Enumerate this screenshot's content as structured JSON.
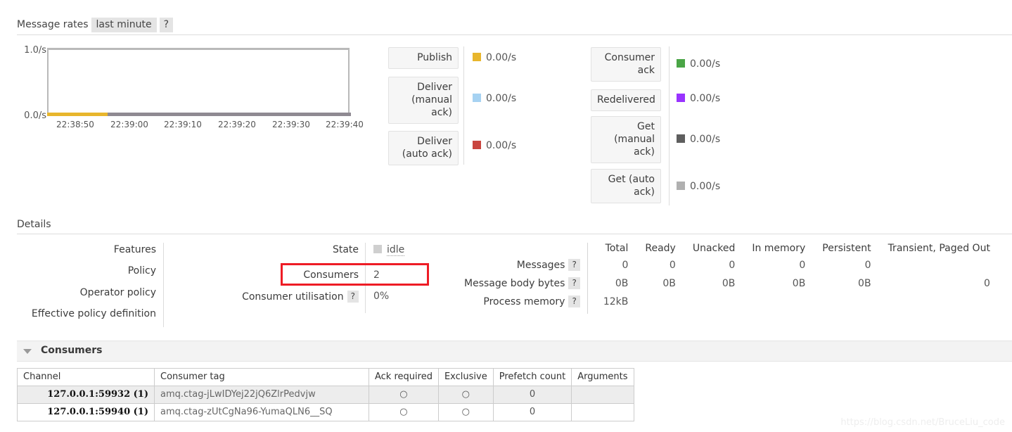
{
  "message_rates": {
    "title": "Message rates",
    "period_tab": "last minute",
    "help_tab": "?"
  },
  "chart_data": {
    "type": "line",
    "title": "Message rates",
    "xlabel": "",
    "ylabel": "",
    "ylim": [
      0.0,
      1.0
    ],
    "ytick_labels": [
      "1.0/s",
      "0.0/s"
    ],
    "x": [
      "22:38:50",
      "22:39:00",
      "22:39:10",
      "22:39:20",
      "22:39:30",
      "22:39:40"
    ],
    "grid": false,
    "legend_position": "right",
    "series": [
      {
        "name": "Publish",
        "value": "0.00/s",
        "color": "#e8b62c",
        "numeric": 0.0
      },
      {
        "name": "Deliver (manual ack)",
        "value": "0.00/s",
        "color": "#a6d2f2",
        "numeric": 0.0
      },
      {
        "name": "Deliver (auto ack)",
        "value": "0.00/s",
        "color": "#c9453f",
        "numeric": 0.0
      },
      {
        "name": "Consumer ack",
        "value": "0.00/s",
        "color": "#4aa546",
        "numeric": 0.0
      },
      {
        "name": "Redelivered",
        "value": "0.00/s",
        "color": "#9933ff",
        "numeric": 0.0
      },
      {
        "name": "Get (manual ack)",
        "value": "0.00/s",
        "color": "#5e5e5e",
        "numeric": 0.0
      },
      {
        "name": "Get (auto ack)",
        "value": "0.00/s",
        "color": "#b0b0b0",
        "numeric": 0.0
      }
    ]
  },
  "rate_legend": {
    "left_buttons": [
      {
        "label": "Publish",
        "value": "0.00/s",
        "color": "#e8b62c"
      },
      {
        "label": "Deliver (manual ack)",
        "value": "0.00/s",
        "color": "#a6d2f2"
      },
      {
        "label": "Deliver (auto ack)",
        "value": "0.00/s",
        "color": "#c9453f"
      }
    ],
    "right_buttons": [
      {
        "label": "Consumer ack",
        "value": "0.00/s",
        "color": "#4aa546"
      },
      {
        "label": "Redelivered",
        "value": "0.00/s",
        "color": "#9933ff"
      },
      {
        "label": "Get (manual ack)",
        "value": "0.00/s",
        "color": "#5e5e5e"
      },
      {
        "label": "Get (auto ack)",
        "value": "0.00/s",
        "color": "#b0b0b0"
      }
    ]
  },
  "details": {
    "title": "Details",
    "left_column": [
      "Features",
      "Policy",
      "Operator policy",
      "Effective policy definition"
    ],
    "middle_rows": [
      {
        "label": "State",
        "help": false,
        "value": "idle",
        "swatch": "#cfcfcf"
      },
      {
        "label": "Consumers",
        "help": false,
        "value": "2",
        "highlighted": true
      },
      {
        "label": "Consumer utilisation",
        "help": true,
        "value": "0%"
      }
    ],
    "stats": {
      "columns": [
        "Total",
        "Ready",
        "Unacked",
        "In memory",
        "Persistent",
        "Transient, Paged Out"
      ],
      "rows": [
        {
          "label": "Messages",
          "help": "?",
          "values": [
            "0",
            "0",
            "0",
            "0",
            "0",
            ""
          ]
        },
        {
          "label": "Message body bytes",
          "help": "?",
          "values": [
            "0B",
            "0B",
            "0B",
            "0B",
            "0B",
            "0"
          ]
        },
        {
          "label": "Process memory",
          "help": "?",
          "values": [
            "12kB",
            "",
            "",
            "",
            "",
            ""
          ]
        }
      ]
    }
  },
  "consumers": {
    "title": "Consumers",
    "columns": [
      "Channel",
      "Consumer tag",
      "Ack required",
      "Exclusive",
      "Prefetch count",
      "Arguments"
    ],
    "rows": [
      {
        "channel": "127.0.0.1:59932 (1)",
        "consumer_tag": "amq.ctag-jLwIDYej22jQ6ZlrPedvjw",
        "ack_required": "○",
        "exclusive": "○",
        "prefetch_count": "0",
        "arguments": ""
      },
      {
        "channel": "127.0.0.1:59940 (1)",
        "consumer_tag": "amq.ctag-zUtCgNa96-YumaQLN6__SQ",
        "ack_required": "○",
        "exclusive": "○",
        "prefetch_count": "0",
        "arguments": ""
      }
    ]
  },
  "watermark": "https://blog.csdn.net/BruceLiu_code"
}
